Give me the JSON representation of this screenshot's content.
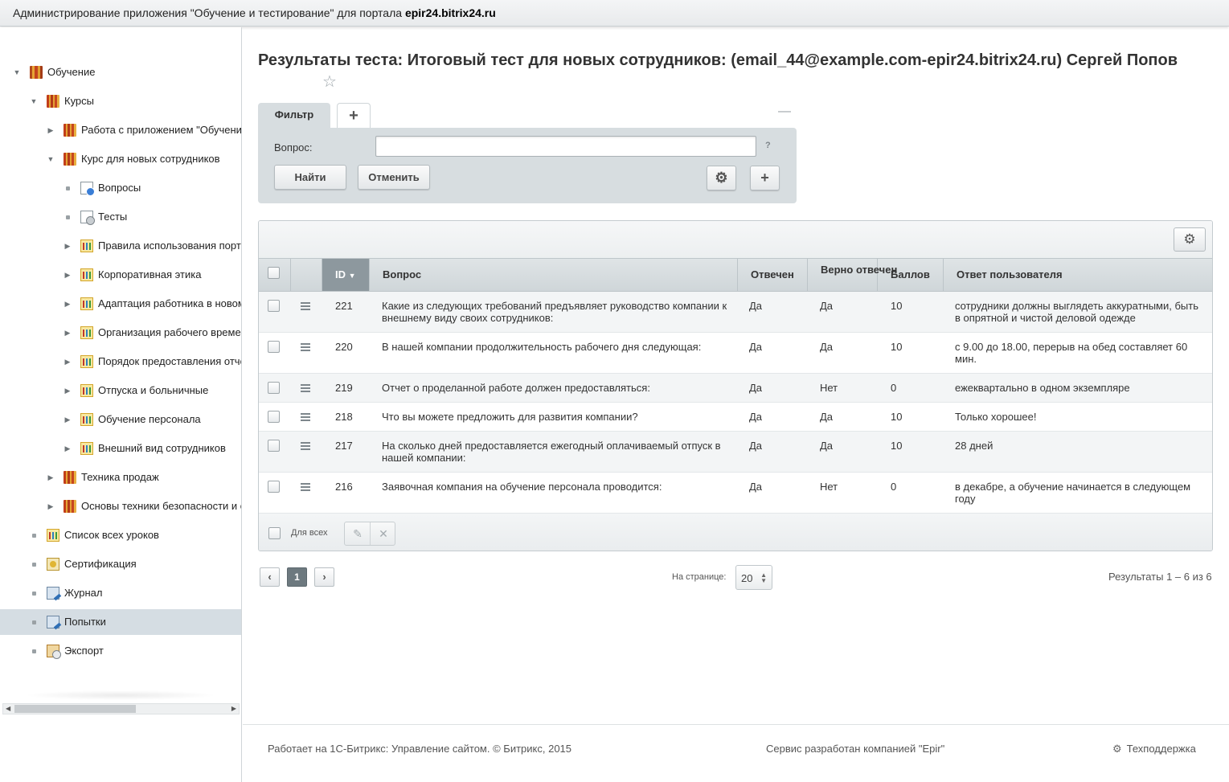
{
  "topbar": {
    "title_prefix": "Администрирование приложения \"Обучение и тестирование\" для портала ",
    "portal": "epir24.bitrix24.ru"
  },
  "sidebar": {
    "items": [
      {
        "label": "Обучение",
        "icon": "book-icon",
        "toggle": "expanded"
      },
      {
        "label": "Курсы",
        "icon": "books-icon",
        "toggle": "expanded"
      },
      {
        "label": "Работа с приложением \"Обучение и тестирование\"",
        "icon": "books-icon",
        "toggle": "collapsed"
      },
      {
        "label": "Курс для новых сотрудников",
        "icon": "books-icon",
        "toggle": "expanded"
      },
      {
        "label": "Вопросы",
        "icon": "question-doc-icon",
        "toggle": "leaf"
      },
      {
        "label": "Тесты",
        "icon": "test-doc-icon",
        "toggle": "leaf"
      },
      {
        "label": "Правила использования портала",
        "icon": "chart-icon",
        "toggle": "collapsed"
      },
      {
        "label": "Корпоративная этика",
        "icon": "chart-icon",
        "toggle": "collapsed"
      },
      {
        "label": "Адаптация работника в новом коллективе",
        "icon": "chart-icon",
        "toggle": "collapsed"
      },
      {
        "label": "Организация рабочего времени",
        "icon": "chart-icon",
        "toggle": "collapsed"
      },
      {
        "label": "Порядок предоставления отчетности",
        "icon": "chart-icon",
        "toggle": "collapsed"
      },
      {
        "label": "Отпуска и больничные",
        "icon": "chart-icon",
        "toggle": "collapsed"
      },
      {
        "label": "Обучение персонала",
        "icon": "chart-icon",
        "toggle": "collapsed"
      },
      {
        "label": "Внешний вид сотрудников",
        "icon": "chart-icon",
        "toggle": "collapsed"
      },
      {
        "label": "Техника продаж",
        "icon": "books-icon",
        "toggle": "collapsed"
      },
      {
        "label": "Основы техники безопасности и охраны труда",
        "icon": "books-icon",
        "toggle": "collapsed"
      },
      {
        "label": "Список всех уроков",
        "icon": "chart-icon",
        "toggle": "leaf"
      },
      {
        "label": "Сертификация",
        "icon": "certificate-icon",
        "toggle": "leaf"
      },
      {
        "label": "Журнал",
        "icon": "journal-icon",
        "toggle": "leaf"
      },
      {
        "label": "Попытки",
        "icon": "attempts-icon",
        "toggle": "leaf",
        "active": true
      },
      {
        "label": "Экспорт",
        "icon": "export-icon",
        "toggle": "leaf"
      }
    ]
  },
  "page": {
    "title": "Результаты теста: Итоговый тест для новых сотрудников: (email_44@example.com-epir24.bitrix24.ru) Сергей Попов"
  },
  "filter": {
    "tab_label": "Фильтр",
    "add_tab": "+",
    "field_label": "Вопрос:",
    "field_value": "",
    "help": "?",
    "find_label": "Найти",
    "cancel_label": "Отменить"
  },
  "grid": {
    "columns": [
      "ID",
      "Вопрос",
      "Отвечен",
      "Верно отвечен",
      "Баллов",
      "Ответ пользователя"
    ],
    "rows": [
      {
        "id": "221",
        "question": "Какие из следующих требований предъявляет руководство компании к внешнему виду своих сотрудников:",
        "answered": "Да",
        "correct": "Да",
        "score": "10",
        "answer": "сотрудники должны выглядеть аккуратными, быть в опрятной и чистой деловой одежде"
      },
      {
        "id": "220",
        "question": "В нашей компании продолжительность рабочего дня следующая:",
        "answered": "Да",
        "correct": "Да",
        "score": "10",
        "answer": "с 9.00 до 18.00, перерыв на обед составляет 60 мин."
      },
      {
        "id": "219",
        "question": "Отчет о проделанной работе должен предоставляться:",
        "answered": "Да",
        "correct": "Нет",
        "score": "0",
        "answer": "ежеквартально в одном экземпляре"
      },
      {
        "id": "218",
        "question": "Что вы можете предложить для развития компании?",
        "answered": "Да",
        "correct": "Да",
        "score": "10",
        "answer": "Только хорошее!"
      },
      {
        "id": "217",
        "question": "На сколько дней предоставляется ежегодный оплачиваемый отпуск в нашей компании:",
        "answered": "Да",
        "correct": "Да",
        "score": "10",
        "answer": "28 дней"
      },
      {
        "id": "216",
        "question": "Заявочная компания на обучение персонала проводится:",
        "answered": "Да",
        "correct": "Нет",
        "score": "0",
        "answer": "в декабре, а обучение начинается в следующем году"
      }
    ],
    "for_all_label": "Для всех"
  },
  "pager": {
    "current_page": "1",
    "per_page_label": "На странице:",
    "per_page_value": "20",
    "results_text": "Результаты 1 – 6 из 6"
  },
  "footer": {
    "left": "Работает на 1С-Битрикс: Управление сайтом. © Битрикс, 2015",
    "center": "Сервис разработан компанией \"Epir\"",
    "support": "Техподдержка"
  }
}
